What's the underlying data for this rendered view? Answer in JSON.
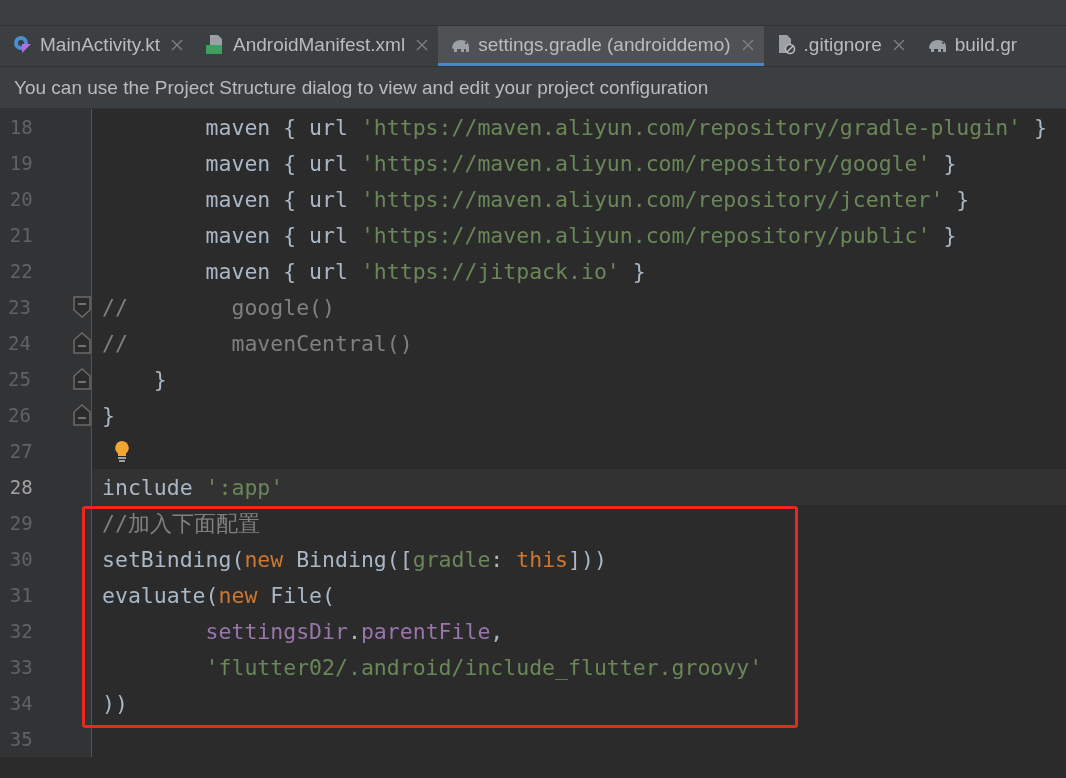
{
  "tabs": [
    {
      "label": "MainActivity.kt",
      "kind": "kotlin",
      "selected": false,
      "closable": true
    },
    {
      "label": "AndroidManifest.xml",
      "kind": "manifest",
      "selected": false,
      "closable": true
    },
    {
      "label": "settings.gradle (androiddemo)",
      "kind": "gradle",
      "selected": true,
      "closable": true
    },
    {
      "label": ".gitignore",
      "kind": "ignore",
      "selected": false,
      "closable": true
    },
    {
      "label": "build.gr",
      "kind": "gradle",
      "selected": false,
      "closable": false
    }
  ],
  "notification": "You can use the Project Structure dialog to view and edit your project configuration",
  "editor": {
    "lines": [
      {
        "number": "18",
        "tokens": [
          {
            "kind": "plain",
            "text": "        maven { url "
          },
          {
            "kind": "string",
            "text": "'https://maven.aliyun.com/repository/gradle-plugin'"
          },
          {
            "kind": "plain",
            "text": " }"
          }
        ]
      },
      {
        "number": "19",
        "tokens": [
          {
            "kind": "plain",
            "text": "        maven { url "
          },
          {
            "kind": "string",
            "text": "'https://maven.aliyun.com/repository/google'"
          },
          {
            "kind": "plain",
            "text": " }"
          }
        ]
      },
      {
        "number": "20",
        "tokens": [
          {
            "kind": "plain",
            "text": "        maven { url "
          },
          {
            "kind": "string",
            "text": "'https://maven.aliyun.com/repository/jcenter'"
          },
          {
            "kind": "plain",
            "text": " }"
          }
        ]
      },
      {
        "number": "21",
        "tokens": [
          {
            "kind": "plain",
            "text": "        maven { url "
          },
          {
            "kind": "string",
            "text": "'https://maven.aliyun.com/repository/public'"
          },
          {
            "kind": "plain",
            "text": " }"
          }
        ]
      },
      {
        "number": "22",
        "tokens": [
          {
            "kind": "plain",
            "text": "        maven { url "
          },
          {
            "kind": "string",
            "text": "'https://jitpack.io'"
          },
          {
            "kind": "plain",
            "text": " }"
          }
        ]
      },
      {
        "number": "23",
        "fold_start": true,
        "tokens": [
          {
            "kind": "comment",
            "text": "//        google()"
          }
        ]
      },
      {
        "number": "24",
        "fold_end": true,
        "tokens": [
          {
            "kind": "comment",
            "text": "//        mavenCentral()"
          }
        ]
      },
      {
        "number": "25",
        "fold_end": true,
        "tokens": [
          {
            "kind": "plain",
            "text": "    }"
          }
        ]
      },
      {
        "number": "26",
        "fold_end": true,
        "tokens": [
          {
            "kind": "plain",
            "text": "}"
          }
        ]
      },
      {
        "number": "27",
        "bulb": true
      },
      {
        "number": "28",
        "current": true,
        "tokens": [
          {
            "kind": "plain",
            "text": "include "
          },
          {
            "kind": "string",
            "text": "':app'"
          }
        ]
      },
      {
        "number": "29",
        "boxed": true,
        "tokens": [
          {
            "kind": "comment",
            "text": "//加入下面配置"
          }
        ]
      },
      {
        "number": "30",
        "boxed": true,
        "tokens": [
          {
            "kind": "plain",
            "text": "setBinding("
          },
          {
            "kind": "keyword",
            "text": "new"
          },
          {
            "kind": "plain",
            "text": " Binding(["
          },
          {
            "kind": "string",
            "text": "gradle"
          },
          {
            "kind": "plain",
            "text": ": "
          },
          {
            "kind": "keyword",
            "text": "this"
          },
          {
            "kind": "plain",
            "text": "]))"
          }
        ]
      },
      {
        "number": "31",
        "boxed": true,
        "tokens": [
          {
            "kind": "plain",
            "text": "evaluate("
          },
          {
            "kind": "keyword",
            "text": "new"
          },
          {
            "kind": "plain",
            "text": " File("
          }
        ]
      },
      {
        "number": "32",
        "boxed": true,
        "tokens": [
          {
            "kind": "field",
            "text": "        settingsDir"
          },
          {
            "kind": "plain",
            "text": "."
          },
          {
            "kind": "field",
            "text": "parentFile"
          },
          {
            "kind": "plain",
            "text": ","
          }
        ]
      },
      {
        "number": "33",
        "boxed": true,
        "tokens": [
          {
            "kind": "string",
            "text": "        'flutter02/.android/include_flutter.groovy'"
          }
        ]
      },
      {
        "number": "34",
        "boxed": true,
        "tokens": [
          {
            "kind": "plain",
            "text": "))"
          }
        ]
      },
      {
        "number": "35"
      }
    ]
  }
}
